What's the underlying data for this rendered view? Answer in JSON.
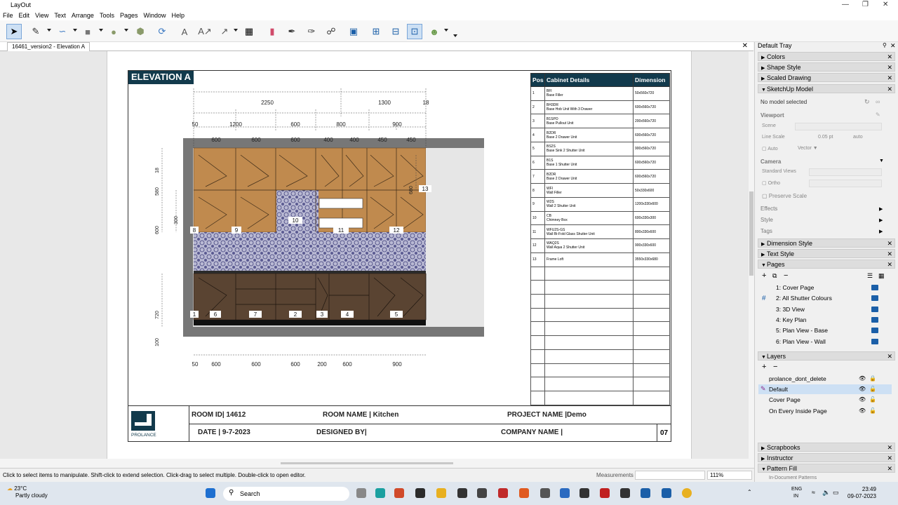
{
  "app": {
    "title": "LayOut"
  },
  "menu": [
    "File",
    "Edit",
    "View",
    "Text",
    "Arrange",
    "Tools",
    "Pages",
    "Window",
    "Help"
  ],
  "doc_tab": "16461_version2 - Elevation A",
  "drawing": {
    "title": "ELEVATION A",
    "top_dims_row1": [
      "2250",
      "1300",
      "18"
    ],
    "top_dims_row2": [
      "50",
      "1200",
      "600",
      "800",
      "900"
    ],
    "top_dims_row3": [
      "600",
      "600",
      "600",
      "400",
      "400",
      "450",
      "450"
    ],
    "bottom_dims": [
      "50",
      "600",
      "600",
      "600",
      "200",
      "600",
      "900"
    ],
    "left_dims": [
      "18",
      "580",
      "300",
      "600",
      "720",
      "100"
    ],
    "side_dim": "680",
    "labels": [
      "8",
      "9",
      "10",
      "11",
      "12",
      "13",
      "1",
      "6",
      "7",
      "2",
      "3",
      "4",
      "5"
    ]
  },
  "cabinet_table": {
    "headers": [
      "Pos",
      "Cabinet Details",
      "Dimension"
    ],
    "rows": [
      {
        "pos": "1",
        "code": "BFl",
        "desc": "Base Filler",
        "dim": "50x560x720"
      },
      {
        "pos": "2",
        "code": "BH3DR",
        "desc": "Base Hob Unit With 3 Drawer",
        "dim": "600x560x720"
      },
      {
        "pos": "3",
        "code": "B1SPO",
        "desc": "Base Pullout Unit",
        "dim": "200x560x720"
      },
      {
        "pos": "4",
        "code": "B2DR",
        "desc": "Base 2 Drawer Unit",
        "dim": "600x560x720"
      },
      {
        "pos": "5",
        "code": "BS2S",
        "desc": "Base Sink 2 Shutter Unit",
        "dim": "900x560x720"
      },
      {
        "pos": "6",
        "code": "B1S",
        "desc": "Base 1 Shutter Unit",
        "dim": "600x560x720"
      },
      {
        "pos": "7",
        "code": "B2DR",
        "desc": "Base 2 Drawer Unit",
        "dim": "600x560x720"
      },
      {
        "pos": "8",
        "code": "WFl",
        "desc": "Wall Filler",
        "dim": "50x330x600"
      },
      {
        "pos": "9",
        "code": "W2S",
        "desc": "Wall 2 Shutter Unit",
        "dim": "1200x330x600"
      },
      {
        "pos": "10",
        "code": "CB",
        "desc": "Chimney Box",
        "dim": "600x330x300"
      },
      {
        "pos": "11",
        "code": "WFU2S-GS",
        "desc": "Wall Bi-Fold Glass Shutter Unit",
        "dim": "800x330x600"
      },
      {
        "pos": "12",
        "code": "WAQ2S",
        "desc": "Wall Aqua 2 Shutter Unit",
        "dim": "900x330x600"
      },
      {
        "pos": "13",
        "code": "",
        "desc": "Frame Loft",
        "dim": "3550x330x680"
      }
    ],
    "empty_rows": 10
  },
  "title_block": {
    "logo_text": "PROLANCE",
    "room_id": "ROOM ID|   14612",
    "room_name": "ROOM NAME |  Kitchen",
    "project_name": "PROJECT NAME |Demo",
    "date": "DATE | 9-7-2023",
    "designed_by": "DESIGNED BY|",
    "company_name": "COMPANY NAME |",
    "page_no": "07"
  },
  "status": {
    "hint": "Click to select items to manipulate. Shift-click to extend selection. Click-drag to select multiple. Double-click to open editor.",
    "measurements_label": "Measurements",
    "zoom": "111%"
  },
  "tray": {
    "title": "Default Tray",
    "sections_top": [
      "Colors",
      "Shape Style",
      "Scaled Drawing",
      "SketchUp Model"
    ],
    "sketchup": {
      "no_model": "No model selected",
      "viewport": "Viewport",
      "scene": "Scene",
      "line_scale": "Line Scale",
      "line_scale_val": "0.05 pt",
      "auto_val": "auto",
      "auto": "Auto",
      "vector": "Vector",
      "camera": "Camera",
      "standard_views": "Standard Views",
      "ortho": "Ortho",
      "preserve_scale": "Preserve Scale",
      "effects": "Effects",
      "style": "Style",
      "tags": "Tags"
    },
    "sections_mid": [
      "Dimension Style",
      "Text Style",
      "Pages"
    ],
    "pages": [
      "1:  Cover Page",
      "2:  All Shutter Colours",
      "3:  3D View",
      "4:  Key Plan",
      "5:  Plan View - Base",
      "6:  Plan View - Wall"
    ],
    "layers_title": "Layers",
    "layers": [
      "prolance_dont_delete",
      "Default",
      "Cover Page",
      "On Every Inside Page"
    ],
    "sections_bottom": [
      "Scrapbooks",
      "Instructor",
      "Pattern Fill"
    ],
    "pattern_sub": "In-Document Patterns"
  },
  "taskbar": {
    "temp": "23°C",
    "weather": "Partly cloudy",
    "search": "Search",
    "lang1": "ENG",
    "lang2": "IN",
    "time": "23:49",
    "date": "09-07-2023"
  }
}
